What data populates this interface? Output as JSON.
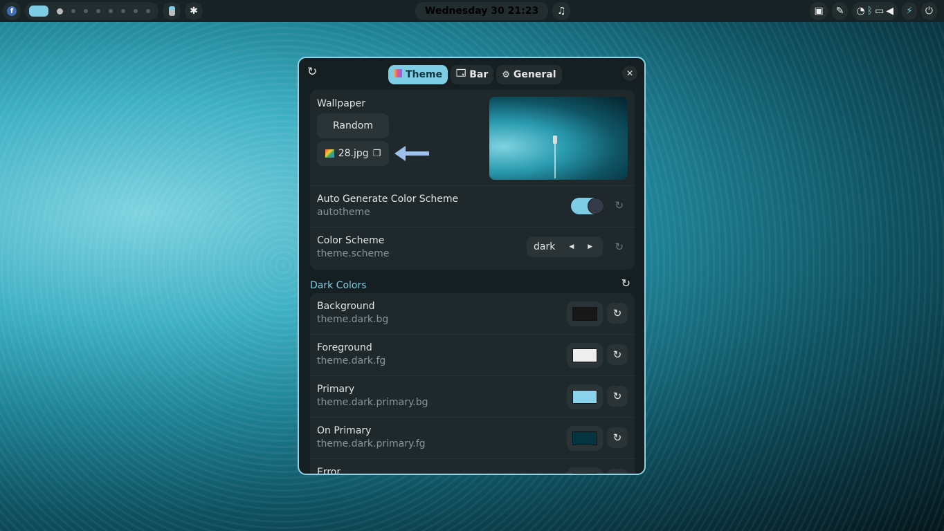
{
  "topbar": {
    "workspaces_count": 9,
    "clock": "Wednesday 30  21:23",
    "icons": [
      "fedora-logo-icon",
      "toggle-icon",
      "gear-icon",
      "music-icon",
      "network-icon",
      "color-picker-icon",
      "speedometer-icon",
      "bluetooth-icon",
      "display-icon",
      "volume-icon",
      "battery-bolt-icon",
      "power-icon"
    ]
  },
  "window": {
    "tabs": [
      {
        "label": "Theme",
        "icon": "palette-icon",
        "active": true
      },
      {
        "label": "Bar",
        "icon": "window-icon"
      },
      {
        "label": "General",
        "icon": "gear-icon"
      }
    ],
    "wallpaper": {
      "label": "Wallpaper",
      "random_label": "Random",
      "file": "28.jpg"
    },
    "autotheme": {
      "title": "Auto Generate Color Scheme",
      "key": "autotheme",
      "enabled": true
    },
    "scheme": {
      "title": "Color Scheme",
      "key": "theme.scheme",
      "value": "dark"
    },
    "dark_colors": {
      "title": "Dark Colors",
      "items": [
        {
          "title": "Background",
          "key": "theme.dark.bg",
          "color": "#171717"
        },
        {
          "title": "Foreground",
          "key": "theme.dark.fg",
          "color": "#eeeeee"
        },
        {
          "title": "Primary",
          "key": "theme.dark.primary.bg",
          "color": "#8bd3eb"
        },
        {
          "title": "On Primary",
          "key": "theme.dark.primary.fg",
          "color": "#043440"
        },
        {
          "title": "Error",
          "key": "",
          "color": "#171717"
        }
      ]
    }
  }
}
